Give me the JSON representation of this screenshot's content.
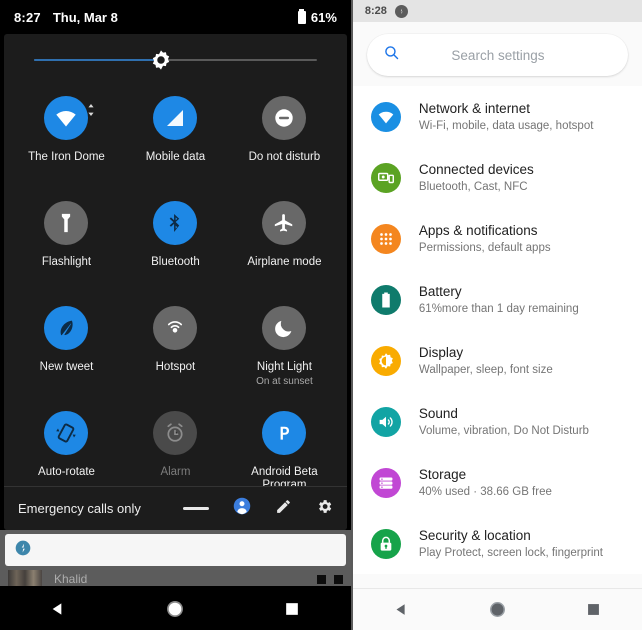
{
  "quick_settings": {
    "status_bar": {
      "time": "8:27",
      "date": "Thu, Mar 8",
      "battery_percent": "61%",
      "battery_icon": "battery-icon"
    },
    "brightness": {
      "icon": "brightness-icon",
      "value_percent": 45,
      "fill_color": "#2f6fae",
      "track_color": "#5a5a5a"
    },
    "tiles": [
      {
        "id": "wifi",
        "label": "The Iron Dome",
        "sub": "",
        "state": "on",
        "icon": "wifi-icon",
        "has_detail_arrow": true
      },
      {
        "id": "mobile-data",
        "label": "Mobile data",
        "sub": "",
        "state": "on",
        "icon": "signal-cellular-icon",
        "has_detail_arrow": false
      },
      {
        "id": "dnd",
        "label": "Do not disturb",
        "sub": "",
        "state": "off",
        "icon": "do-not-disturb-icon",
        "has_detail_arrow": false
      },
      {
        "id": "flashlight",
        "label": "Flashlight",
        "sub": "",
        "state": "off",
        "icon": "flashlight-icon",
        "has_detail_arrow": false
      },
      {
        "id": "bluetooth",
        "label": "Bluetooth",
        "sub": "",
        "state": "on",
        "icon": "bluetooth-icon",
        "has_detail_arrow": false
      },
      {
        "id": "airplane",
        "label": "Airplane mode",
        "sub": "",
        "state": "off",
        "icon": "airplane-icon",
        "has_detail_arrow": false
      },
      {
        "id": "new-tweet",
        "label": "New tweet",
        "sub": "",
        "state": "on",
        "icon": "feather-icon",
        "has_detail_arrow": false
      },
      {
        "id": "hotspot",
        "label": "Hotspot",
        "sub": "",
        "state": "off",
        "icon": "hotspot-icon",
        "has_detail_arrow": false
      },
      {
        "id": "night-light",
        "label": "Night Light",
        "sub": "On at sunset",
        "state": "off",
        "icon": "moon-icon",
        "has_detail_arrow": false
      },
      {
        "id": "auto-rotate",
        "label": "Auto-rotate",
        "sub": "",
        "state": "on",
        "icon": "screen-rotation-icon",
        "has_detail_arrow": false
      },
      {
        "id": "alarm",
        "label": "Alarm",
        "sub": "",
        "state": "dim",
        "icon": "alarm-icon",
        "has_detail_arrow": false
      },
      {
        "id": "android-beta",
        "label": "Android Beta Program",
        "sub": "",
        "state": "on",
        "icon": "android-beta-icon",
        "has_detail_arrow": false
      }
    ],
    "footer": {
      "carrier_text": "Emergency calls only",
      "icons": [
        {
          "id": "collapse-handle",
          "icon": "dash-handle-icon"
        },
        {
          "id": "user",
          "icon": "user-avatar-icon"
        },
        {
          "id": "edit",
          "icon": "pencil-icon"
        },
        {
          "id": "settings",
          "icon": "gear-icon"
        }
      ]
    },
    "notification": {
      "card_icon": "app-badge-icon",
      "sender": "Khalid"
    },
    "nav_bar": {
      "back": "back-triangle-icon",
      "home": "home-circle-icon",
      "recents": "recents-square-icon"
    }
  },
  "settings_app": {
    "status_bar": {
      "time": "8:28",
      "icon": "app-badge-icon"
    },
    "search": {
      "icon": "search-icon",
      "placeholder": "Search settings",
      "value": ""
    },
    "items": [
      {
        "title": "Network & internet",
        "sub": "Wi-Fi, mobile, data usage, hotspot",
        "icon": "wifi-icon",
        "color": "#1a8fe3"
      },
      {
        "title": "Connected devices",
        "sub": "Bluetooth, Cast, NFC",
        "icon": "connected-devices-icon",
        "color": "#5ba323"
      },
      {
        "title": "Apps & notifications",
        "sub": "Permissions, default apps",
        "icon": "apps-grid-icon",
        "color": "#f4861f"
      },
      {
        "title": "Battery",
        "sub": "61%more than 1 day remaining",
        "icon": "battery-icon",
        "color": "#0f7b6c"
      },
      {
        "title": "Display",
        "sub": "Wallpaper, sleep, font size",
        "icon": "brightness-icon",
        "color": "#f9ab00"
      },
      {
        "title": "Sound",
        "sub": "Volume, vibration, Do Not Disturb",
        "icon": "volume-icon",
        "color": "#12a4a4"
      },
      {
        "title": "Storage",
        "sub": "40% used · 38.66 GB free",
        "icon": "storage-icon",
        "color": "#c147d4"
      },
      {
        "title": "Security & location",
        "sub": "Play Protect, screen lock, fingerprint",
        "icon": "lock-icon",
        "color": "#16a34a"
      }
    ],
    "nav_bar": {
      "back": "back-triangle-icon",
      "home": "home-circle-icon",
      "recents": "recents-square-icon"
    }
  }
}
